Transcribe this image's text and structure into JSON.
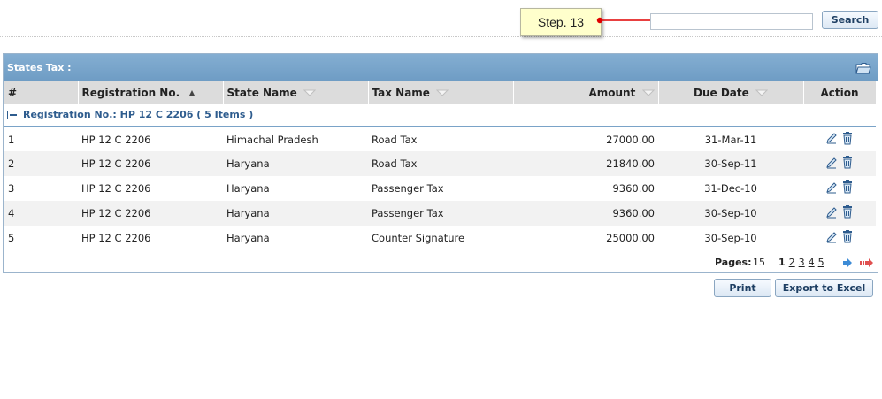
{
  "topbar": {
    "step_label": "Step. 13",
    "search_value": "",
    "search_button": "Search"
  },
  "panel": {
    "title": "States Tax :",
    "columns": [
      "#",
      "Registration No.",
      "State Name",
      "Tax Name",
      "Amount",
      "Due Date",
      "Action"
    ],
    "group_label": "Registration No.: HP 12 C 2206 ( 5 Items )",
    "rows": [
      {
        "num": "1",
        "reg": "HP 12 C 2206",
        "state": "Himachal Pradesh",
        "tax": "Road Tax",
        "amount": "27000.00",
        "due": "31-Mar-11"
      },
      {
        "num": "2",
        "reg": "HP 12 C 2206",
        "state": "Haryana",
        "tax": "Road Tax",
        "amount": "21840.00",
        "due": "30-Sep-11"
      },
      {
        "num": "3",
        "reg": "HP 12 C 2206",
        "state": "Haryana",
        "tax": "Passenger Tax",
        "amount": "9360.00",
        "due": "31-Dec-10"
      },
      {
        "num": "4",
        "reg": "HP 12 C 2206",
        "state": "Haryana",
        "tax": "Passenger Tax",
        "amount": "9360.00",
        "due": "30-Sep-10"
      },
      {
        "num": "5",
        "reg": "HP 12 C 2206",
        "state": "Haryana",
        "tax": "Counter Signature",
        "amount": "25000.00",
        "due": "30-Sep-10"
      }
    ],
    "pager": {
      "label": "Pages:",
      "count": "15",
      "pages": [
        "1",
        "2",
        "3",
        "4",
        "5"
      ],
      "current": "1"
    }
  },
  "footer": {
    "print_button": "Print",
    "export_button": "Export to Excel"
  },
  "colors": {
    "header_blue": "#74a2c9",
    "group_text": "#2e5c8e",
    "callout_bg": "#ffffcc",
    "arrow_red": "#e00000"
  }
}
